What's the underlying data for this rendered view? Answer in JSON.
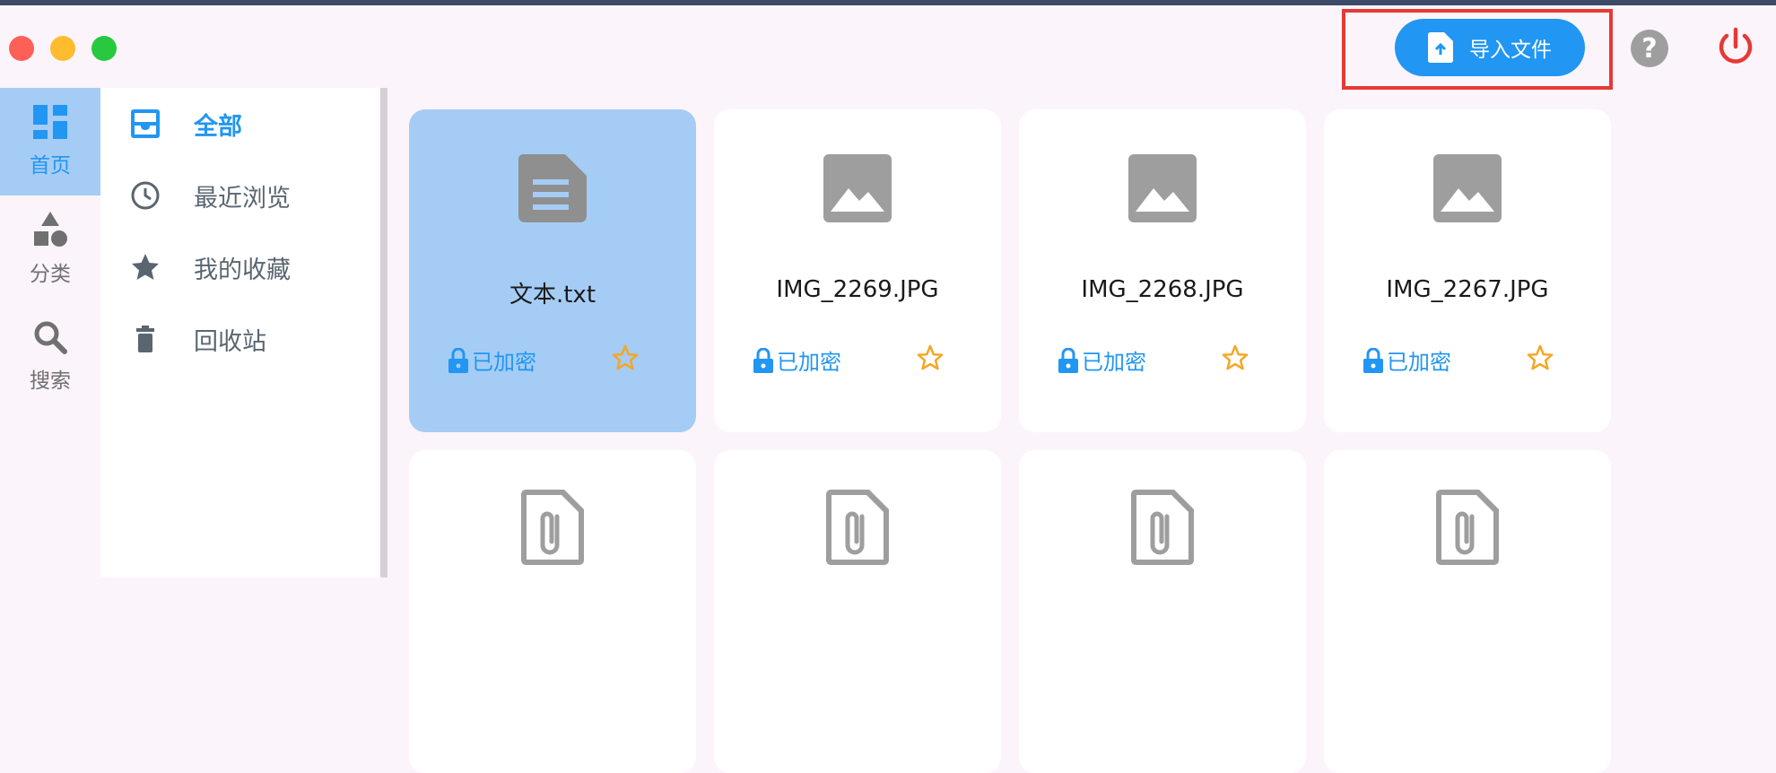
{
  "header": {
    "import_label": "导入文件",
    "help_symbol": "?"
  },
  "rail": {
    "items": [
      {
        "label": "首页",
        "icon": "dashboard-icon",
        "active": true
      },
      {
        "label": "分类",
        "icon": "category-shapes-icon",
        "active": false
      },
      {
        "label": "搜索",
        "icon": "search-icon",
        "active": false
      }
    ]
  },
  "menu": {
    "items": [
      {
        "label": "全部",
        "icon": "inbox-icon",
        "active": true
      },
      {
        "label": "最近浏览",
        "icon": "clock-icon",
        "active": false
      },
      {
        "label": "我的收藏",
        "icon": "star-icon",
        "active": false
      },
      {
        "label": "回收站",
        "icon": "trash-icon",
        "active": false
      }
    ]
  },
  "files": [
    {
      "name": "文本.txt",
      "type": "document",
      "status": "已加密",
      "selected": true,
      "icon": "document-icon"
    },
    {
      "name": "IMG_2269.JPG",
      "type": "image",
      "status": "已加密",
      "selected": false,
      "icon": "image-icon"
    },
    {
      "name": "IMG_2268.JPG",
      "type": "image",
      "status": "已加密",
      "selected": false,
      "icon": "image-icon"
    },
    {
      "name": "IMG_2267.JPG",
      "type": "image",
      "status": "已加密",
      "selected": false,
      "icon": "image-icon"
    }
  ],
  "files_row2_icons": [
    "attachment-file-icon",
    "attachment-file-icon",
    "attachment-file-icon",
    "attachment-file-icon"
  ],
  "colors": {
    "accent": "#2196f3",
    "selected_card": "#a5ccf4",
    "star": "#f5a623",
    "power": "#e53935",
    "highlight_border": "#e53935"
  }
}
